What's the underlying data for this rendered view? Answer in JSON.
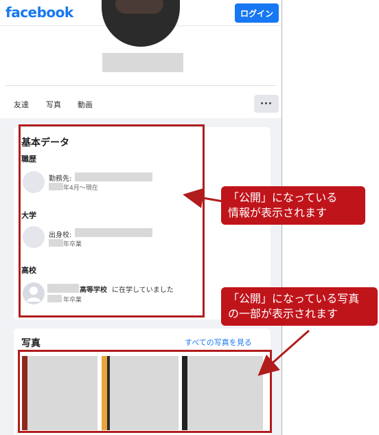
{
  "header": {
    "logo": "facebook",
    "login_label": "ログイン"
  },
  "profile": {
    "tabs": [
      "友達",
      "写真",
      "動画"
    ],
    "more_label": "···"
  },
  "basic": {
    "title": "基本データ",
    "work": {
      "section": "職歴",
      "label": "勤務先:",
      "period": "年4月～現在"
    },
    "college": {
      "section": "大学",
      "label": "出身校:",
      "status": "年卒業"
    },
    "highschool": {
      "section": "高校",
      "school_name": "高等学校",
      "sentence": "に在学していました",
      "status": "年卒業"
    }
  },
  "photos": {
    "title": "写真",
    "see_all": "すべての写真を見る"
  },
  "annotations": {
    "callout1_line1": "「公開」になっている",
    "callout1_line2": "情報が表示されます",
    "callout2_line1": "「公開」になっている写真",
    "callout2_line2": "の一部が表示されます",
    "color": "#c0141b"
  }
}
